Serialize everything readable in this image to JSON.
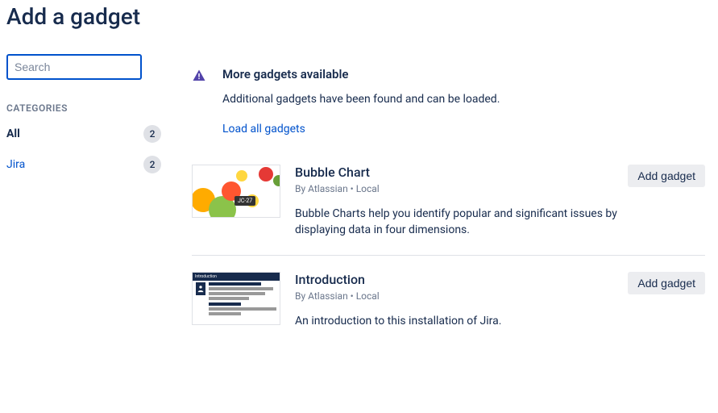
{
  "header": {
    "title": "Add a gadget"
  },
  "sidebar": {
    "search": {
      "placeholder": "Search",
      "value": ""
    },
    "categories_heading": "CATEGORIES",
    "categories": [
      {
        "label": "All",
        "count": "2",
        "active": true
      },
      {
        "label": "Jira",
        "count": "2",
        "active": false
      }
    ]
  },
  "notice": {
    "title": "More gadgets available",
    "text": "Additional gadgets have been found and can be loaded.",
    "link": "Load all gadgets"
  },
  "gadgets": [
    {
      "title": "Bubble Chart",
      "meta": "By Atlassian • Local",
      "desc": "Bubble Charts help you identify popular and significant issues by displaying data in four dimensions.",
      "button": "Add gadget",
      "thumb_label": "JC-27"
    },
    {
      "title": "Introduction",
      "meta": "By Atlassian • Local",
      "desc": "An introduction to this installation of Jira.",
      "button": "Add gadget"
    }
  ]
}
